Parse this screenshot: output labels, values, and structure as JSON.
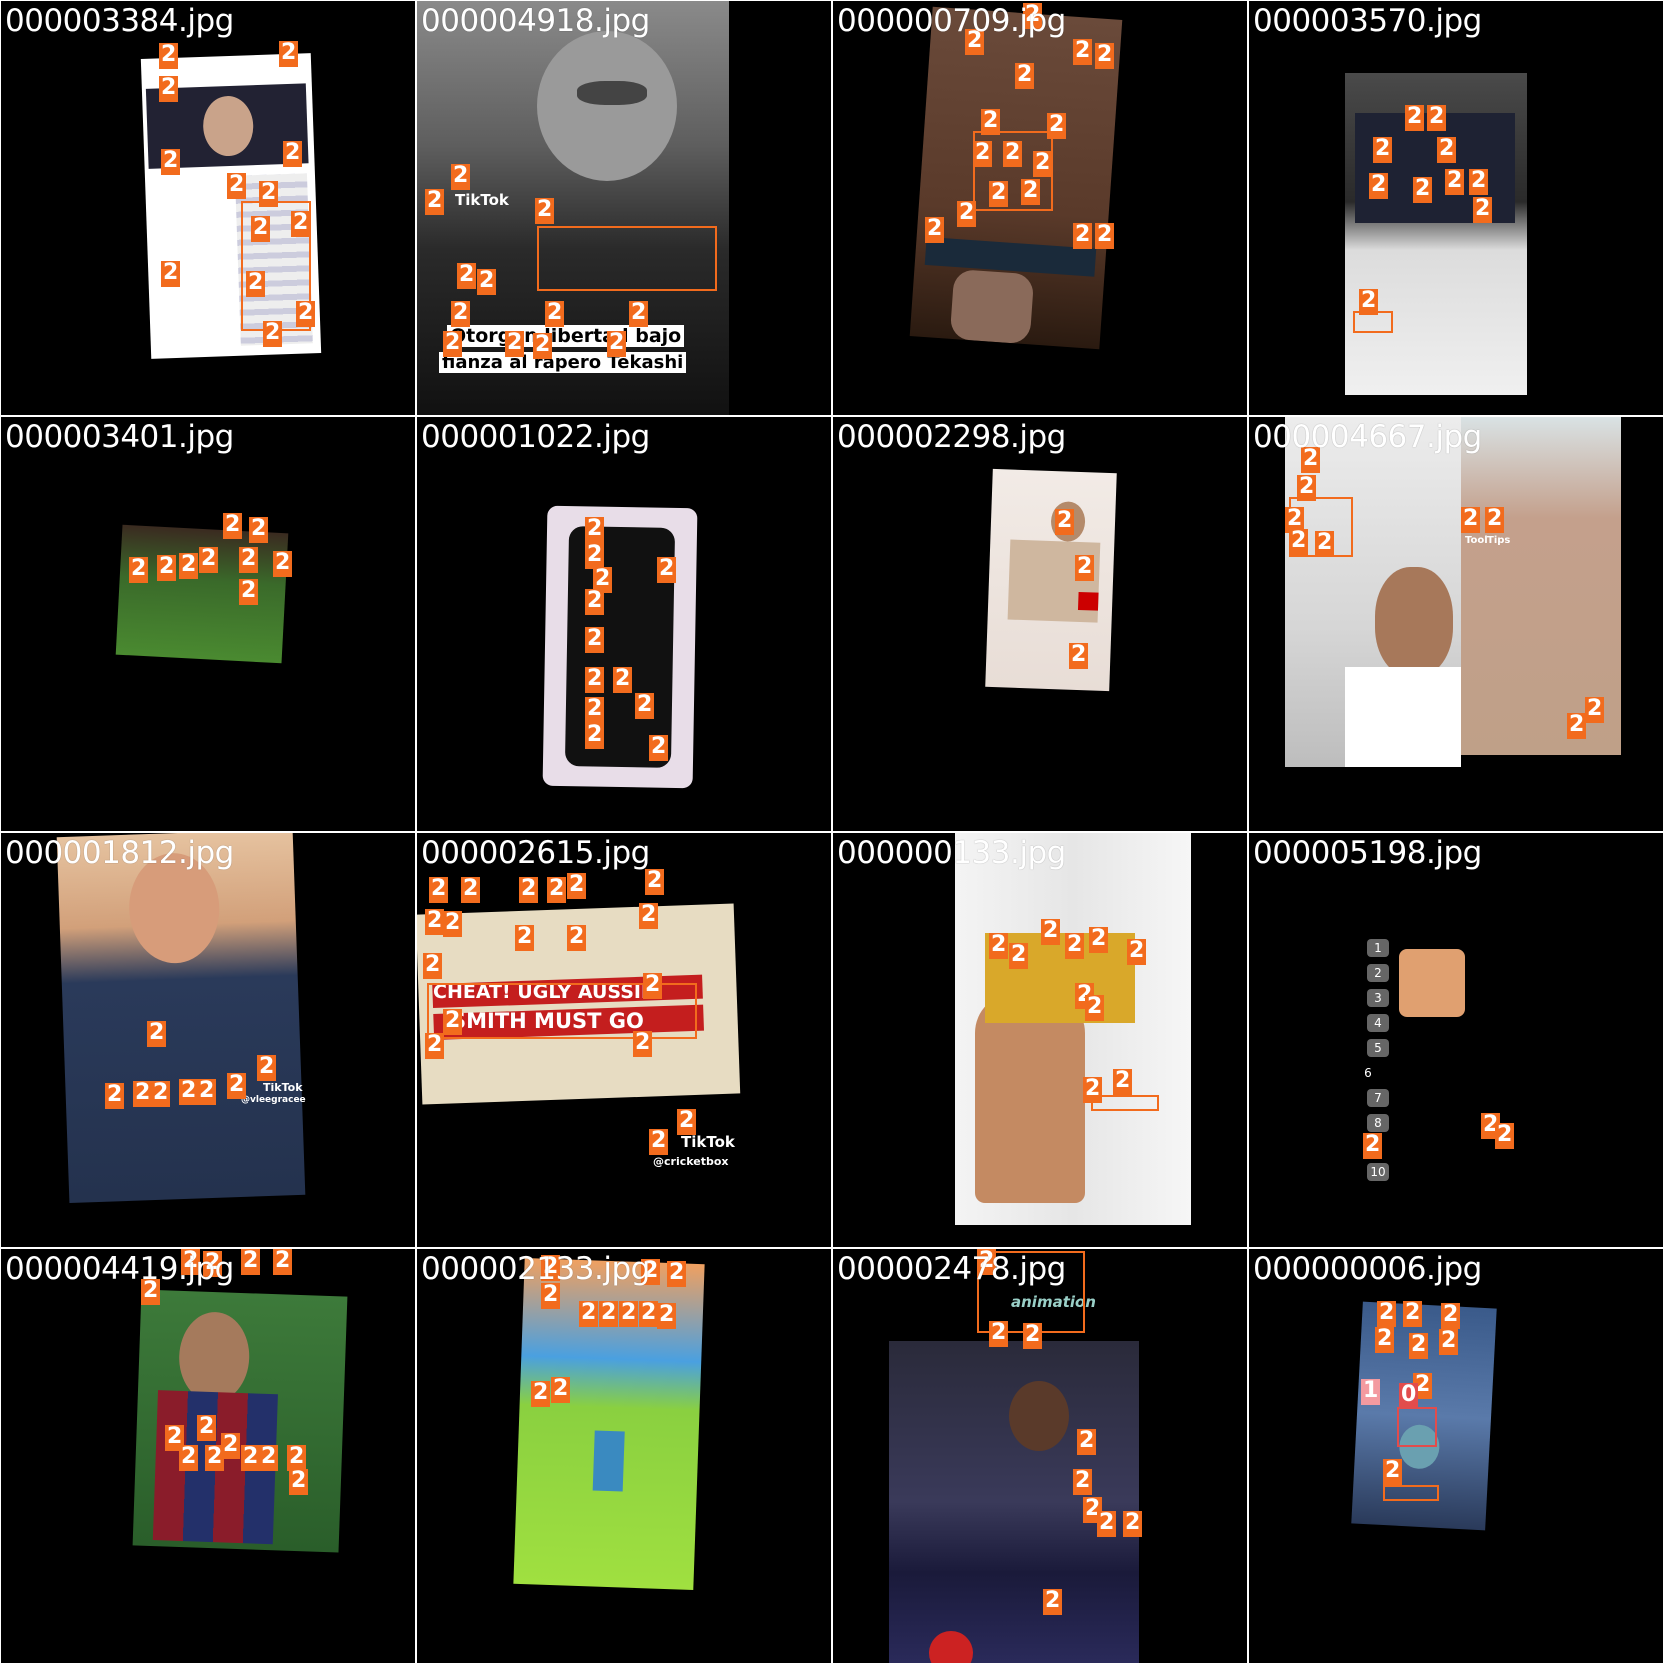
{
  "label_class": "2",
  "colors": {
    "label": "#f26b1d",
    "tile_bg": "#000000",
    "grid_line": "#ffffff"
  },
  "tiles": [
    {
      "filename": "000003384.jpg"
    },
    {
      "filename": "000004918.jpg",
      "tiktok_label": "TikTok",
      "caption_line1": "Otorgan libertad bajo",
      "caption_line2": "fianza al rapero Tekashi"
    },
    {
      "filename": "000000709.jpg"
    },
    {
      "filename": "000003570.jpg"
    },
    {
      "filename": "000003401.jpg"
    },
    {
      "filename": "000001022.jpg"
    },
    {
      "filename": "000002298.jpg"
    },
    {
      "filename": "000004667.jpg",
      "side_labels": [
        "Tool",
        "Tips"
      ]
    },
    {
      "filename": "000001812.jpg",
      "tiktok_label": "TikTok",
      "handle": "@vleegracee"
    },
    {
      "filename": "000002615.jpg",
      "headline1": "CHEAT! UGLY AUSSIE!",
      "headline2": "SMITH MUST GO",
      "tiktok_label": "TikTok",
      "handle": "@cricketbox"
    },
    {
      "filename": "000000133.jpg"
    },
    {
      "filename": "000005198.jpg",
      "ranks": [
        "1",
        "2",
        "3",
        "4",
        "5",
        "6",
        "7",
        "8",
        "10"
      ]
    },
    {
      "filename": "000004419.jpg"
    },
    {
      "filename": "000002133.jpg"
    },
    {
      "filename": "000002478.jpg",
      "logo_text": "animation"
    },
    {
      "filename": "000000006.jpg",
      "special_labels": [
        "1",
        "0"
      ]
    }
  ]
}
